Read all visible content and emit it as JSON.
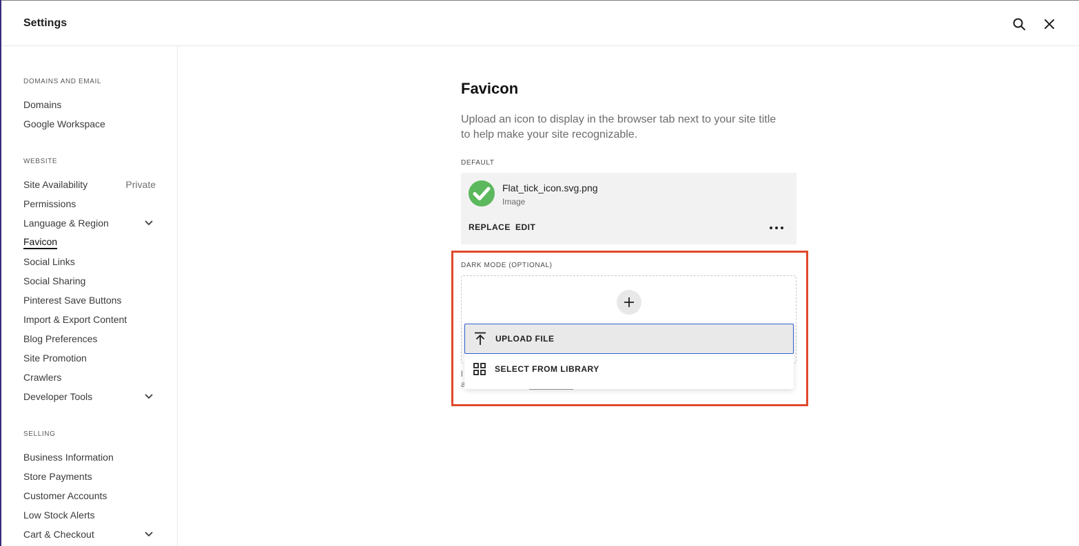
{
  "header": {
    "title": "Settings"
  },
  "sidebar": {
    "sections": [
      {
        "label": "DOMAINS AND EMAIL",
        "items": [
          {
            "label": "Domains"
          },
          {
            "label": "Google Workspace"
          }
        ]
      },
      {
        "label": "WEBSITE",
        "items": [
          {
            "label": "Site Availability",
            "status": "Private"
          },
          {
            "label": "Permissions"
          },
          {
            "label": "Language & Region",
            "expandable": true
          },
          {
            "label": "Favicon",
            "active": true
          },
          {
            "label": "Social Links"
          },
          {
            "label": "Social Sharing"
          },
          {
            "label": "Pinterest Save Buttons"
          },
          {
            "label": "Import & Export Content"
          },
          {
            "label": "Blog Preferences"
          },
          {
            "label": "Site Promotion"
          },
          {
            "label": "Crawlers"
          },
          {
            "label": "Developer Tools",
            "expandable": true
          }
        ]
      },
      {
        "label": "SELLING",
        "items": [
          {
            "label": "Business Information"
          },
          {
            "label": "Store Payments"
          },
          {
            "label": "Customer Accounts"
          },
          {
            "label": "Low Stock Alerts"
          },
          {
            "label": "Cart & Checkout",
            "expandable": true
          }
        ]
      }
    ]
  },
  "main": {
    "title": "Favicon",
    "description": "Upload an icon to display in the browser tab next to your site title to help make your site recognizable.",
    "default_label": "DEFAULT",
    "file": {
      "name": "Flat_tick_icon.svg.png",
      "type": "Image",
      "replace_label": "REPLACE",
      "edit_label": "EDIT"
    },
    "dark_mode_label": "DARK MODE (OPTIONAL)",
    "peek_text_1": "l",
    "peek_text_2": "a",
    "menu": {
      "upload_label": "UPLOAD FILE",
      "library_label": "SELECT FROM LIBRARY"
    }
  },
  "colors": {
    "highlight": "#e0482b",
    "focus": "#2f5fd0",
    "tick_green": "#5cb85c"
  }
}
